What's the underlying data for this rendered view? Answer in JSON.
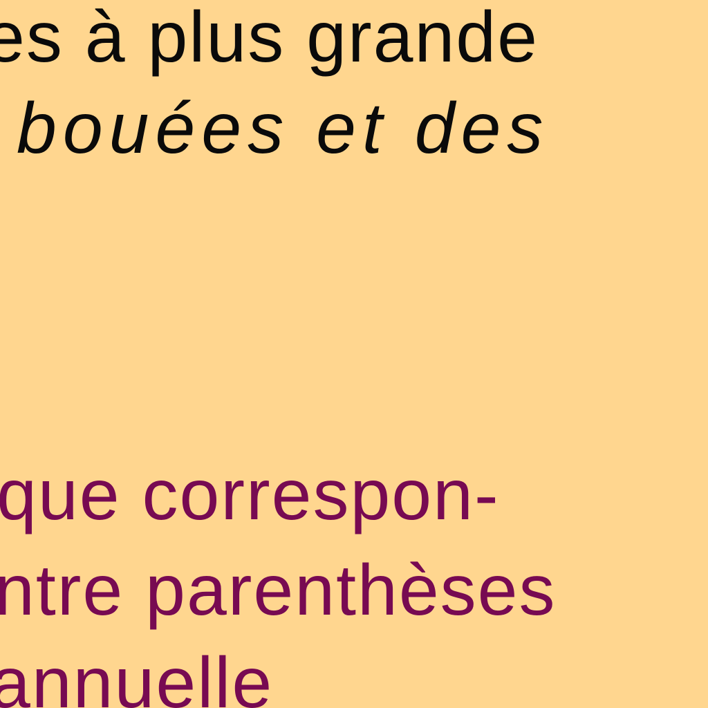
{
  "colors": {
    "background": "#FFD68F",
    "text_black": "#0a0a0a",
    "text_purple": "#770A52"
  },
  "document": {
    "black_lines": [
      "es à plus grande",
      "bouées et des"
    ],
    "purple_lines": [
      "ique correspon-",
      "ntre parenthèses",
      "annuelle"
    ]
  }
}
